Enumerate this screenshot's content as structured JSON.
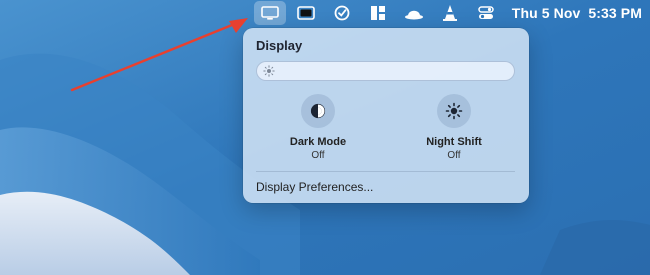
{
  "menubar": {
    "icons": [
      "display-icon",
      "window-icon",
      "checkmark-circle-icon",
      "dashboard-icon",
      "hat-icon",
      "traffic-cone-icon",
      "control-center-icon"
    ],
    "date": "Thu 5 Nov",
    "time": "5:33 PM"
  },
  "panel": {
    "title": "Display",
    "brightness": 0.0,
    "toggles": [
      {
        "label": "Dark Mode",
        "state": "Off",
        "icon": "dark-mode-icon"
      },
      {
        "label": "Night Shift",
        "state": "Off",
        "icon": "night-shift-icon"
      }
    ],
    "preferences_link": "Display Preferences..."
  },
  "colors": {
    "arrow": "#e8402f",
    "panel_bg": "#cfe1f4"
  }
}
